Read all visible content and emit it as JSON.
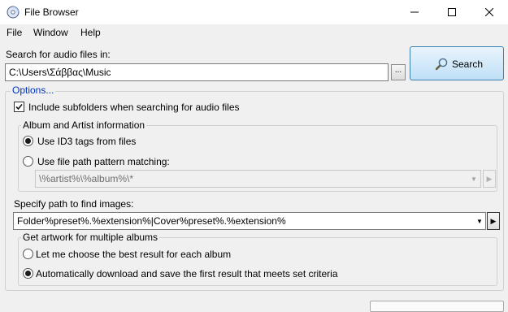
{
  "window": {
    "title": "File Browser"
  },
  "menu": {
    "items": [
      "File",
      "Window",
      "Help"
    ]
  },
  "search": {
    "label": "Search for audio files in:",
    "path": "C:\\Users\\Σάββας\\Music",
    "browse_label": "...",
    "button_label": "Search"
  },
  "options": {
    "title": "Options...",
    "include_subfolders": {
      "label": "Include subfolders when searching for audio files",
      "checked": true
    },
    "album_artist": {
      "title": "Album and Artist information",
      "use_id3": {
        "label": "Use ID3 tags from files",
        "selected": true
      },
      "use_pattern": {
        "label": "Use file path pattern matching:",
        "selected": false
      },
      "pattern_value": "\\%artist%\\%album%\\*"
    },
    "images": {
      "label": "Specify path to find images:",
      "path_value": "Folder%preset%.%extension%|Cover%preset%.%extension%"
    },
    "artwork": {
      "title": "Get artwork for multiple albums",
      "choose_best": {
        "label": "Let me choose the best result for each album",
        "selected": false
      },
      "auto_download": {
        "label": "Automatically download and save the first result that meets set criteria",
        "selected": true
      }
    }
  },
  "icons": {
    "app": "cd-disc-icon",
    "search": "magnifier-icon",
    "minimize": "minimize-icon",
    "maximize": "maximize-icon",
    "close": "close-icon",
    "dropdown": "chevron-down-icon",
    "play": "play-arrow-icon"
  },
  "colors": {
    "window_bg": "#f0f0f0",
    "search_button_bg": "#bfe0f7",
    "search_button_border": "#3c7fb1",
    "group_title_blue": "#0033bc"
  }
}
